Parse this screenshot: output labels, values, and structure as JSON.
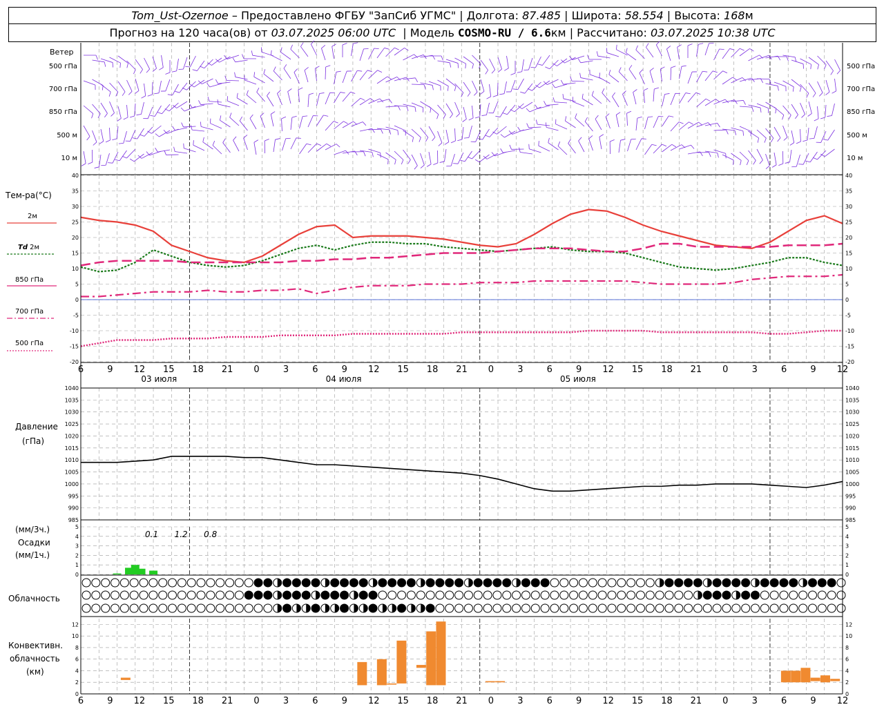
{
  "header": {
    "station": "Tom_Ust-Ozernoe",
    "provider": "– Предоставлено ФГБУ \"ЗапСиб УГМС\"",
    "lon_label": "Долгота:",
    "lon": "87.485",
    "lat_label": "Широта:",
    "lat": "58.554",
    "alt_label": "Высота:",
    "alt": "168",
    "alt_unit": "м",
    "forecast_label": "Прогноз на 120 часа(ов) от",
    "forecast_from": "03.07.2025 06:00 UTC",
    "model_label": "Модель",
    "model": "COSMO-RU / 6.6",
    "model_unit": "км",
    "calc_label": "Рассчитано:",
    "calc": "03.07.2025 10:38 UTC"
  },
  "labels": {
    "wind": "Ветер",
    "wind_levels": [
      "500 гПа",
      "700 гПа",
      "850 гПа",
      "500 м",
      "10 м"
    ],
    "temp": "Тем-ра(°С)",
    "t2m": "2м",
    "td": "Td",
    "td_suffix": "2м",
    "l850": "850 гПа",
    "l700": "700 гПа",
    "l500": "500 гПа",
    "pressure": "Давление",
    "pressure_unit": "(гПа)",
    "precip_unit1": "(мм/3ч.)",
    "precip": "Осадки",
    "precip_unit2": "(мм/1ч.)",
    "cloud": "Облачность",
    "conv1": "Конвективн.",
    "conv2": "облачность",
    "conv3": "(км)"
  },
  "colors": {
    "t2m": "#e8403a",
    "td2m": "#1a7a1a",
    "t850": "#e0287a",
    "t500": "#e0287a",
    "wind": "#7a2ee0",
    "precip": "#22cc22",
    "conv": "#f08a30",
    "grid": "#9a9a9a",
    "zero": "#2244cc"
  },
  "chart_data": [
    {
      "type": "line",
      "name": "temperature",
      "ylim": [
        -20,
        40
      ],
      "yticks": [
        -20,
        -15,
        -10,
        -5,
        0,
        5,
        10,
        15,
        20,
        25,
        30,
        35,
        40
      ],
      "x_hours_from_start": [
        0,
        3,
        6,
        9,
        12,
        15,
        18,
        21,
        24,
        27,
        30,
        33,
        36,
        39,
        42,
        45,
        48,
        51,
        54,
        57,
        60,
        63,
        66,
        69,
        72,
        75,
        78,
        81,
        84,
        87,
        90,
        93,
        96,
        99,
        102,
        105,
        108,
        111,
        114,
        117,
        120,
        123,
        126
      ],
      "x_tick_labels": [
        "6",
        "9",
        "12",
        "15",
        "18",
        "21",
        "0",
        "3",
        "6",
        "9",
        "12",
        "15",
        "18",
        "21",
        "0",
        "3",
        "6",
        "9",
        "12",
        "15",
        "18",
        "21",
        "0",
        "3",
        "6",
        "9",
        "12"
      ],
      "date_labels": [
        "03 июля",
        "04 июля",
        "05 июля"
      ],
      "series": [
        {
          "name": "2м",
          "values": [
            26.5,
            25.5,
            25,
            24,
            22,
            17.5,
            15.5,
            13.5,
            12.5,
            12,
            14,
            17.5,
            21,
            23.5,
            24,
            20,
            20.5,
            20.5,
            20.5,
            20,
            19.5,
            18.5,
            17.5,
            17,
            18,
            21,
            24.5,
            27.5,
            29,
            28.5,
            26.5,
            24,
            22,
            20.5,
            19,
            17.5,
            17,
            16.5,
            18.5,
            22,
            25.5,
            27,
            24.5
          ]
        },
        {
          "name": "Td 2м",
          "values": [
            10.5,
            9,
            9.5,
            12,
            16,
            14,
            12,
            11,
            10.5,
            11,
            12.5,
            14.5,
            16.5,
            17.5,
            16,
            17.5,
            18.5,
            18.5,
            18,
            18,
            17,
            16.5,
            16,
            15.5,
            16,
            16.5,
            17,
            16,
            15.5,
            15.5,
            15,
            13.5,
            12,
            10.5,
            10,
            9.5,
            10,
            11,
            12,
            13.5,
            13.5,
            12,
            11
          ]
        },
        {
          "name": "850 гПа",
          "values": [
            11,
            12,
            12.5,
            12.5,
            12.5,
            12.5,
            12,
            12,
            12,
            12,
            12,
            12,
            12.5,
            12.5,
            13,
            13,
            13.5,
            13.5,
            14,
            14.5,
            15,
            15,
            15,
            15.5,
            16,
            16.5,
            16.5,
            16.5,
            16,
            15.5,
            15.5,
            16.5,
            18,
            18,
            17,
            17,
            17,
            17,
            17,
            17.5,
            17.5,
            17.5,
            18
          ]
        },
        {
          "name": "700 гПа",
          "values": [
            1,
            1,
            1.5,
            2,
            2.5,
            2.5,
            2.5,
            3,
            2.5,
            2.5,
            3,
            3,
            3.5,
            2,
            3,
            4,
            4.5,
            4.5,
            4.5,
            5,
            5,
            5,
            5.5,
            5.5,
            5.5,
            6,
            6,
            6,
            6,
            6,
            6,
            5.5,
            5,
            5,
            5,
            5,
            5.5,
            6.5,
            7,
            7.5,
            7.5,
            7.5,
            8
          ]
        },
        {
          "name": "500 гПа",
          "values": [
            -15,
            -14,
            -13,
            -13,
            -13,
            -12.5,
            -12.5,
            -12.5,
            -12,
            -12,
            -12,
            -11.5,
            -11.5,
            -11.5,
            -11.5,
            -11,
            -11,
            -11,
            -11,
            -11,
            -11,
            -10.5,
            -10.5,
            -10.5,
            -10.5,
            -10.5,
            -10.5,
            -10.5,
            -10,
            -10,
            -10,
            -10,
            -10.5,
            -10.5,
            -10.5,
            -10.5,
            -10.5,
            -10.5,
            -11,
            -11,
            -10.5,
            -10,
            -10
          ]
        }
      ]
    },
    {
      "type": "line",
      "name": "pressure",
      "ylim": [
        985,
        1040
      ],
      "yticks": [
        985,
        990,
        995,
        1000,
        1005,
        1010,
        1015,
        1020,
        1025,
        1030,
        1035,
        1040
      ],
      "series": [
        {
          "name": "Давление",
          "values": [
            1009,
            1009,
            1009,
            1009.5,
            1010,
            1011.5,
            1011.5,
            1011.5,
            1011.5,
            1011,
            1011,
            1010,
            1009,
            1008,
            1008,
            1007.5,
            1007,
            1006.5,
            1006,
            1005.5,
            1005,
            1004.5,
            1003.5,
            1002,
            1000,
            998,
            997,
            997,
            997.5,
            998,
            998.5,
            999,
            999,
            999.5,
            999.5,
            1000,
            1000,
            1000,
            999.5,
            999,
            998.5,
            999.5,
            1001
          ]
        }
      ]
    },
    {
      "type": "bar",
      "name": "precipitation",
      "ylim": [
        0,
        5
      ],
      "yticks": [
        0,
        1,
        2,
        3,
        4,
        5
      ],
      "totals_3h": [
        {
          "hour": 6,
          "value": "0.1"
        },
        {
          "hour": 9,
          "value": "1.2"
        },
        {
          "hour": 12,
          "value": "0.8"
        }
      ],
      "bars": [
        {
          "hour": 6,
          "value": 0.1
        },
        {
          "hour": 8,
          "value": 0.7
        },
        {
          "hour": 9,
          "value": 1.0
        },
        {
          "hour": 10,
          "value": 0.6
        },
        {
          "hour": 12,
          "value": 0.4
        }
      ]
    },
    {
      "type": "bar",
      "name": "convective_cloud",
      "ylim": [
        0,
        13
      ],
      "yticks": [
        0,
        2,
        4,
        6,
        8,
        10,
        12
      ],
      "bars": [
        {
          "hour": 7,
          "low": 2.4,
          "high": 2.8
        },
        {
          "hour": 31,
          "low": 1.5,
          "high": 5.5
        },
        {
          "hour": 33,
          "low": 1.5,
          "high": 6.0
        },
        {
          "hour": 34,
          "low": 1.6,
          "high": 1.8
        },
        {
          "hour": 35,
          "low": 1.8,
          "high": 9.2
        },
        {
          "hour": 37,
          "low": 4.5,
          "high": 5.0
        },
        {
          "hour": 38,
          "low": 1.5,
          "high": 10.8
        },
        {
          "hour": 39,
          "low": 1.5,
          "high": 12.5
        },
        {
          "hour": 44,
          "low": 2.0,
          "high": 2.2
        },
        {
          "hour": 45,
          "low": 2.0,
          "high": 2.2
        },
        {
          "hour": 74,
          "low": 2.0,
          "high": 4.0
        },
        {
          "hour": 75,
          "low": 2.0,
          "high": 4.0
        },
        {
          "hour": 76,
          "low": 2.0,
          "high": 4.5
        },
        {
          "hour": 77,
          "low": 2.2,
          "high": 2.8
        },
        {
          "hour": 78,
          "low": 2.0,
          "high": 3.2
        },
        {
          "hour": 79,
          "low": 2.2,
          "high": 2.6
        },
        {
          "hour": 102,
          "low": 3.2,
          "high": 3.8
        },
        {
          "hour": 103,
          "low": 3.2,
          "high": 3.8
        },
        {
          "hour": 105,
          "low": 3.5,
          "high": 4.0
        },
        {
          "hour": 106,
          "low": 3.5,
          "high": 4.0
        }
      ]
    }
  ]
}
